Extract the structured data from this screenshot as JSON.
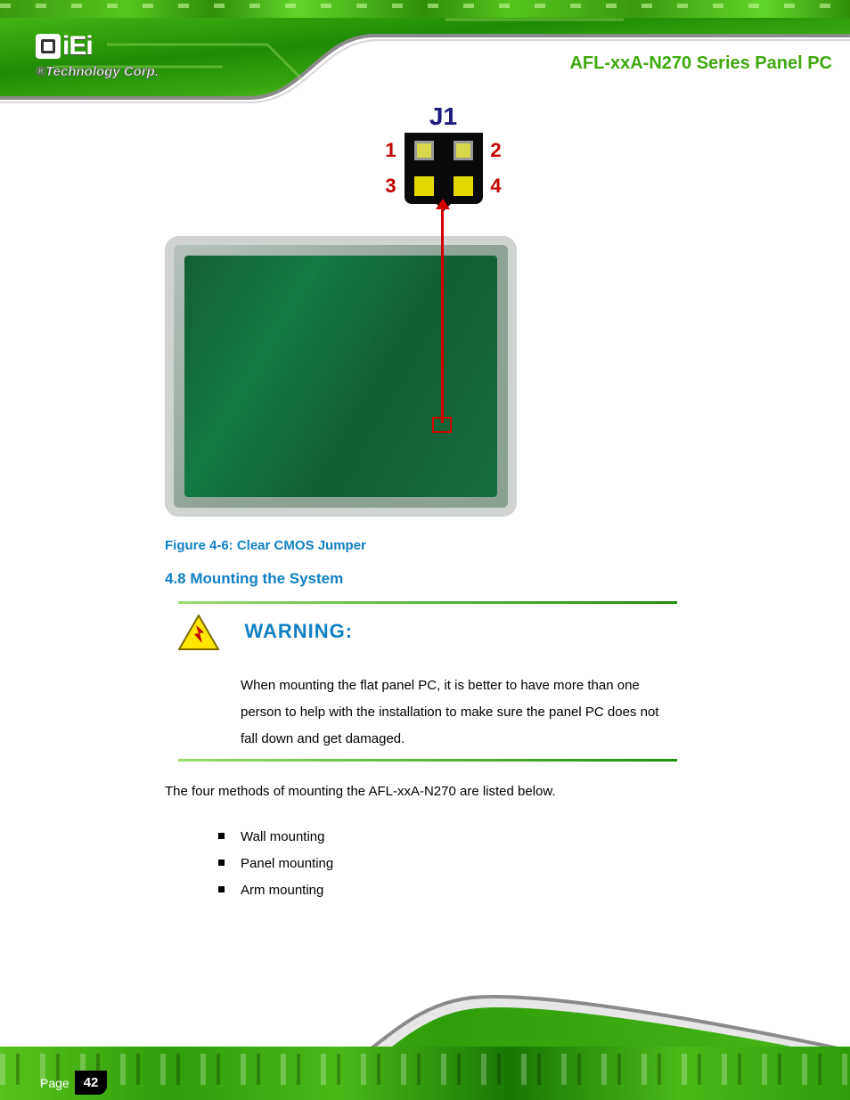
{
  "header": {
    "logo_brand": "iEi",
    "logo_tagline": "®Technology Corp.",
    "product_label": "AFL-xxA-N270 Series Panel PC"
  },
  "diagram": {
    "connector_label": "J1",
    "pin_labels": {
      "tl": "1",
      "tr": "2",
      "bl": "3",
      "br": "4"
    }
  },
  "figure_caption": "Figure 4-6: Clear CMOS Jumper",
  "section_heading": "4.8 Mounting the System",
  "warning": {
    "title": "WARNING:",
    "text": "When mounting the flat panel PC, it is better to have more than one person to help with the installation to make sure the panel PC does not fall down and get damaged."
  },
  "body_para": "The four methods of mounting the AFL-xxA-N270 are listed below.",
  "bullets": [
    "Wall mounting",
    "Panel mounting",
    "Arm mounting"
  ],
  "footer": {
    "page_label": "Page",
    "page_number": "42"
  }
}
